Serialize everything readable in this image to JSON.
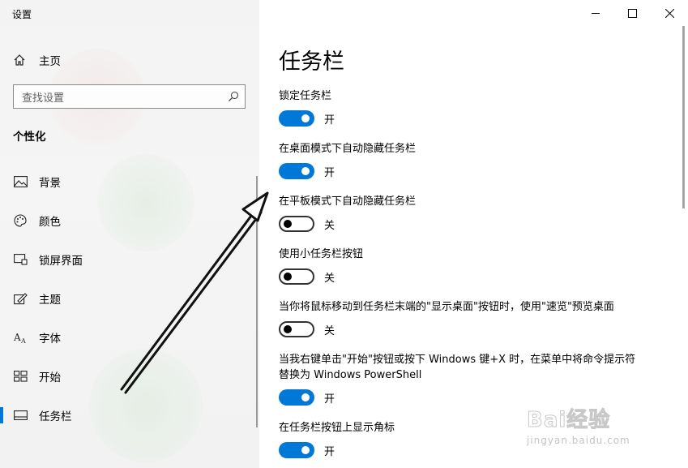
{
  "window": {
    "title": "设置"
  },
  "sidebar": {
    "home_label": "主页",
    "search_placeholder": "查找设置",
    "section_title": "个性化",
    "items": [
      {
        "label": "背景",
        "icon": "picture-icon"
      },
      {
        "label": "颜色",
        "icon": "palette-icon"
      },
      {
        "label": "锁屏界面",
        "icon": "lock-screen-icon"
      },
      {
        "label": "主题",
        "icon": "theme-icon"
      },
      {
        "label": "字体",
        "icon": "font-icon"
      },
      {
        "label": "开始",
        "icon": "start-icon"
      },
      {
        "label": "任务栏",
        "icon": "taskbar-icon",
        "active": true
      }
    ]
  },
  "main": {
    "page_title": "任务栏",
    "settings": [
      {
        "label": "锁定任务栏",
        "state": "开",
        "on": true
      },
      {
        "label": "在桌面模式下自动隐藏任务栏",
        "state": "开",
        "on": true
      },
      {
        "label": "在平板模式下自动隐藏任务栏",
        "state": "关",
        "on": false
      },
      {
        "label": "使用小任务栏按钮",
        "state": "关",
        "on": false
      },
      {
        "label": "当你将鼠标移动到任务栏末端的\"显示桌面\"按钮时，使用\"速览\"预览桌面",
        "state": "关",
        "on": false
      },
      {
        "label": "当我右键单击\"开始\"按钮或按下 Windows 键+X 时，在菜单中将命令提示符替换为 Windows PowerShell",
        "state": "开",
        "on": true
      },
      {
        "label": "在任务栏按钮上显示角标",
        "state": "开",
        "on": true
      }
    ]
  },
  "watermark": {
    "logo": "Bai经验",
    "url": "jingyan.baidu.com"
  },
  "colors": {
    "accent": "#0078d7",
    "sidebar_bg": "#f3f3f3"
  }
}
